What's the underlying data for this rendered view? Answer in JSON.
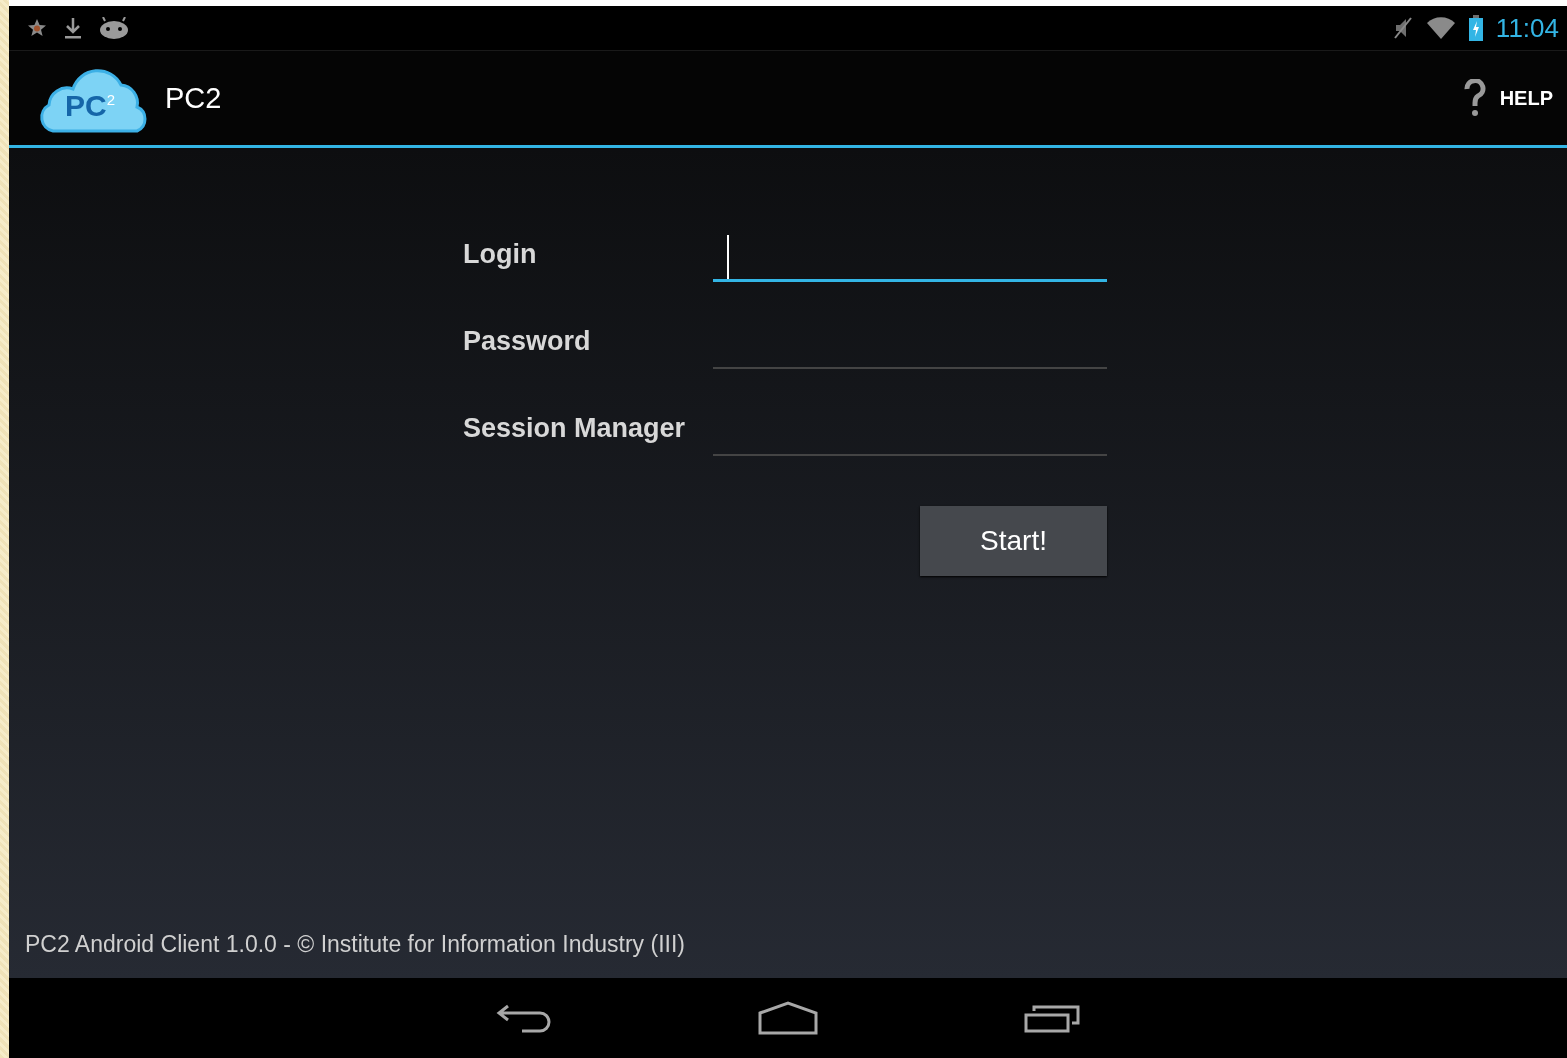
{
  "status_bar": {
    "time": "11:04"
  },
  "action_bar": {
    "logo_text": "PC$^{2}$",
    "title": "PC2",
    "help_label": "HELP"
  },
  "form": {
    "fields": [
      {
        "label": "Login",
        "focused": true
      },
      {
        "label": "Password",
        "focused": false
      },
      {
        "label": "Session Manager",
        "focused": false
      }
    ],
    "submit_button": "Start!"
  },
  "footer": "PC2 Android Client 1.0.0 - © Institute for Information Industry (III)"
}
